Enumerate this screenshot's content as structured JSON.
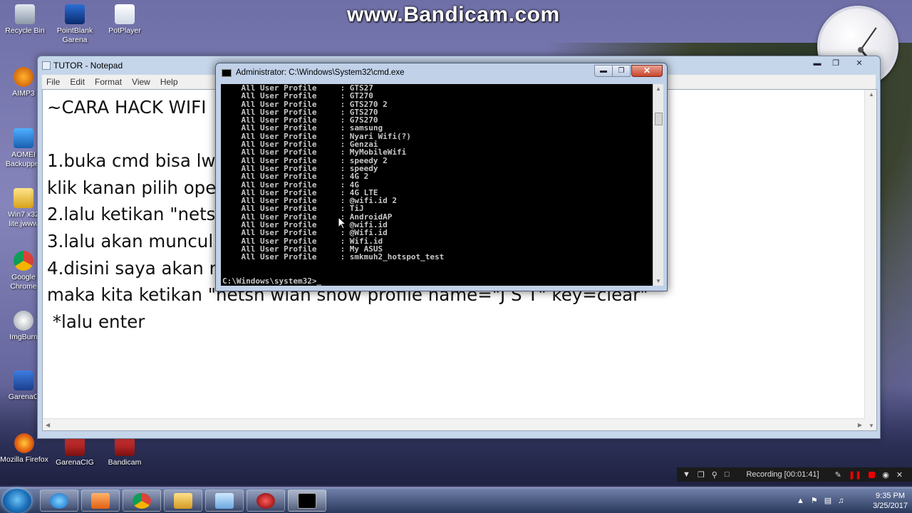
{
  "watermark": "www.Bandicam.com",
  "desktop_icons": [
    {
      "label": "Recycle Bin"
    },
    {
      "label": "PointBlank Garena"
    },
    {
      "label": "PotPlayer"
    },
    {
      "label": "AIMP3"
    },
    {
      "label": "AOMEI Backupper"
    },
    {
      "label": "Win7 x32 lite.jwww"
    },
    {
      "label": "Google Chrome"
    },
    {
      "label": "ImgBurn"
    },
    {
      "label": "GarenaC"
    },
    {
      "label": "Mozilla Firefox"
    },
    {
      "label": "GarenaCIG"
    },
    {
      "label": "Bandicam"
    }
  ],
  "notepad": {
    "title": "TUTOR - Notepad",
    "menu": [
      "File",
      "Edit",
      "Format",
      "View",
      "Help"
    ],
    "lines": [
      "~CARA HACK WIFI",
      "",
      "1.buka cmd bisa lwt",
      "klik kanan pilih ope",
      "2.lalu ketikan \"nets",
      "3.lalu akan muncul",
      "4.disini saya akan m",
      "maka kita ketikan \"netsh wlan show profile name=\"J S T\" key=clear\"",
      " *lalu enter"
    ]
  },
  "cmd": {
    "title": "Administrator: C:\\Windows\\System32\\cmd.exe",
    "profile_label": "All User Profile",
    "profiles": [
      "GTS27",
      "GT270",
      "GTS270 2",
      "GTS270",
      "G7S270",
      "samsung",
      "Nyari Wifi(?)",
      "Genzai",
      "MyMobileWifi",
      "speedy 2",
      "speedy",
      "4G 2",
      "4G",
      "4G LTE",
      "@wifi.id 2",
      "TiJ",
      "AndroidAP",
      "@wifi.id",
      "@Wifi.id",
      "Wifi.id",
      "My ASUS",
      "smkmuh2_hotspot_test"
    ],
    "prompt": "C:\\Windows\\system32>_"
  },
  "recording": {
    "label": "Recording [00:01:41]"
  },
  "taskbar": {
    "time": "9:35 PM",
    "date": "3/25/2017"
  }
}
